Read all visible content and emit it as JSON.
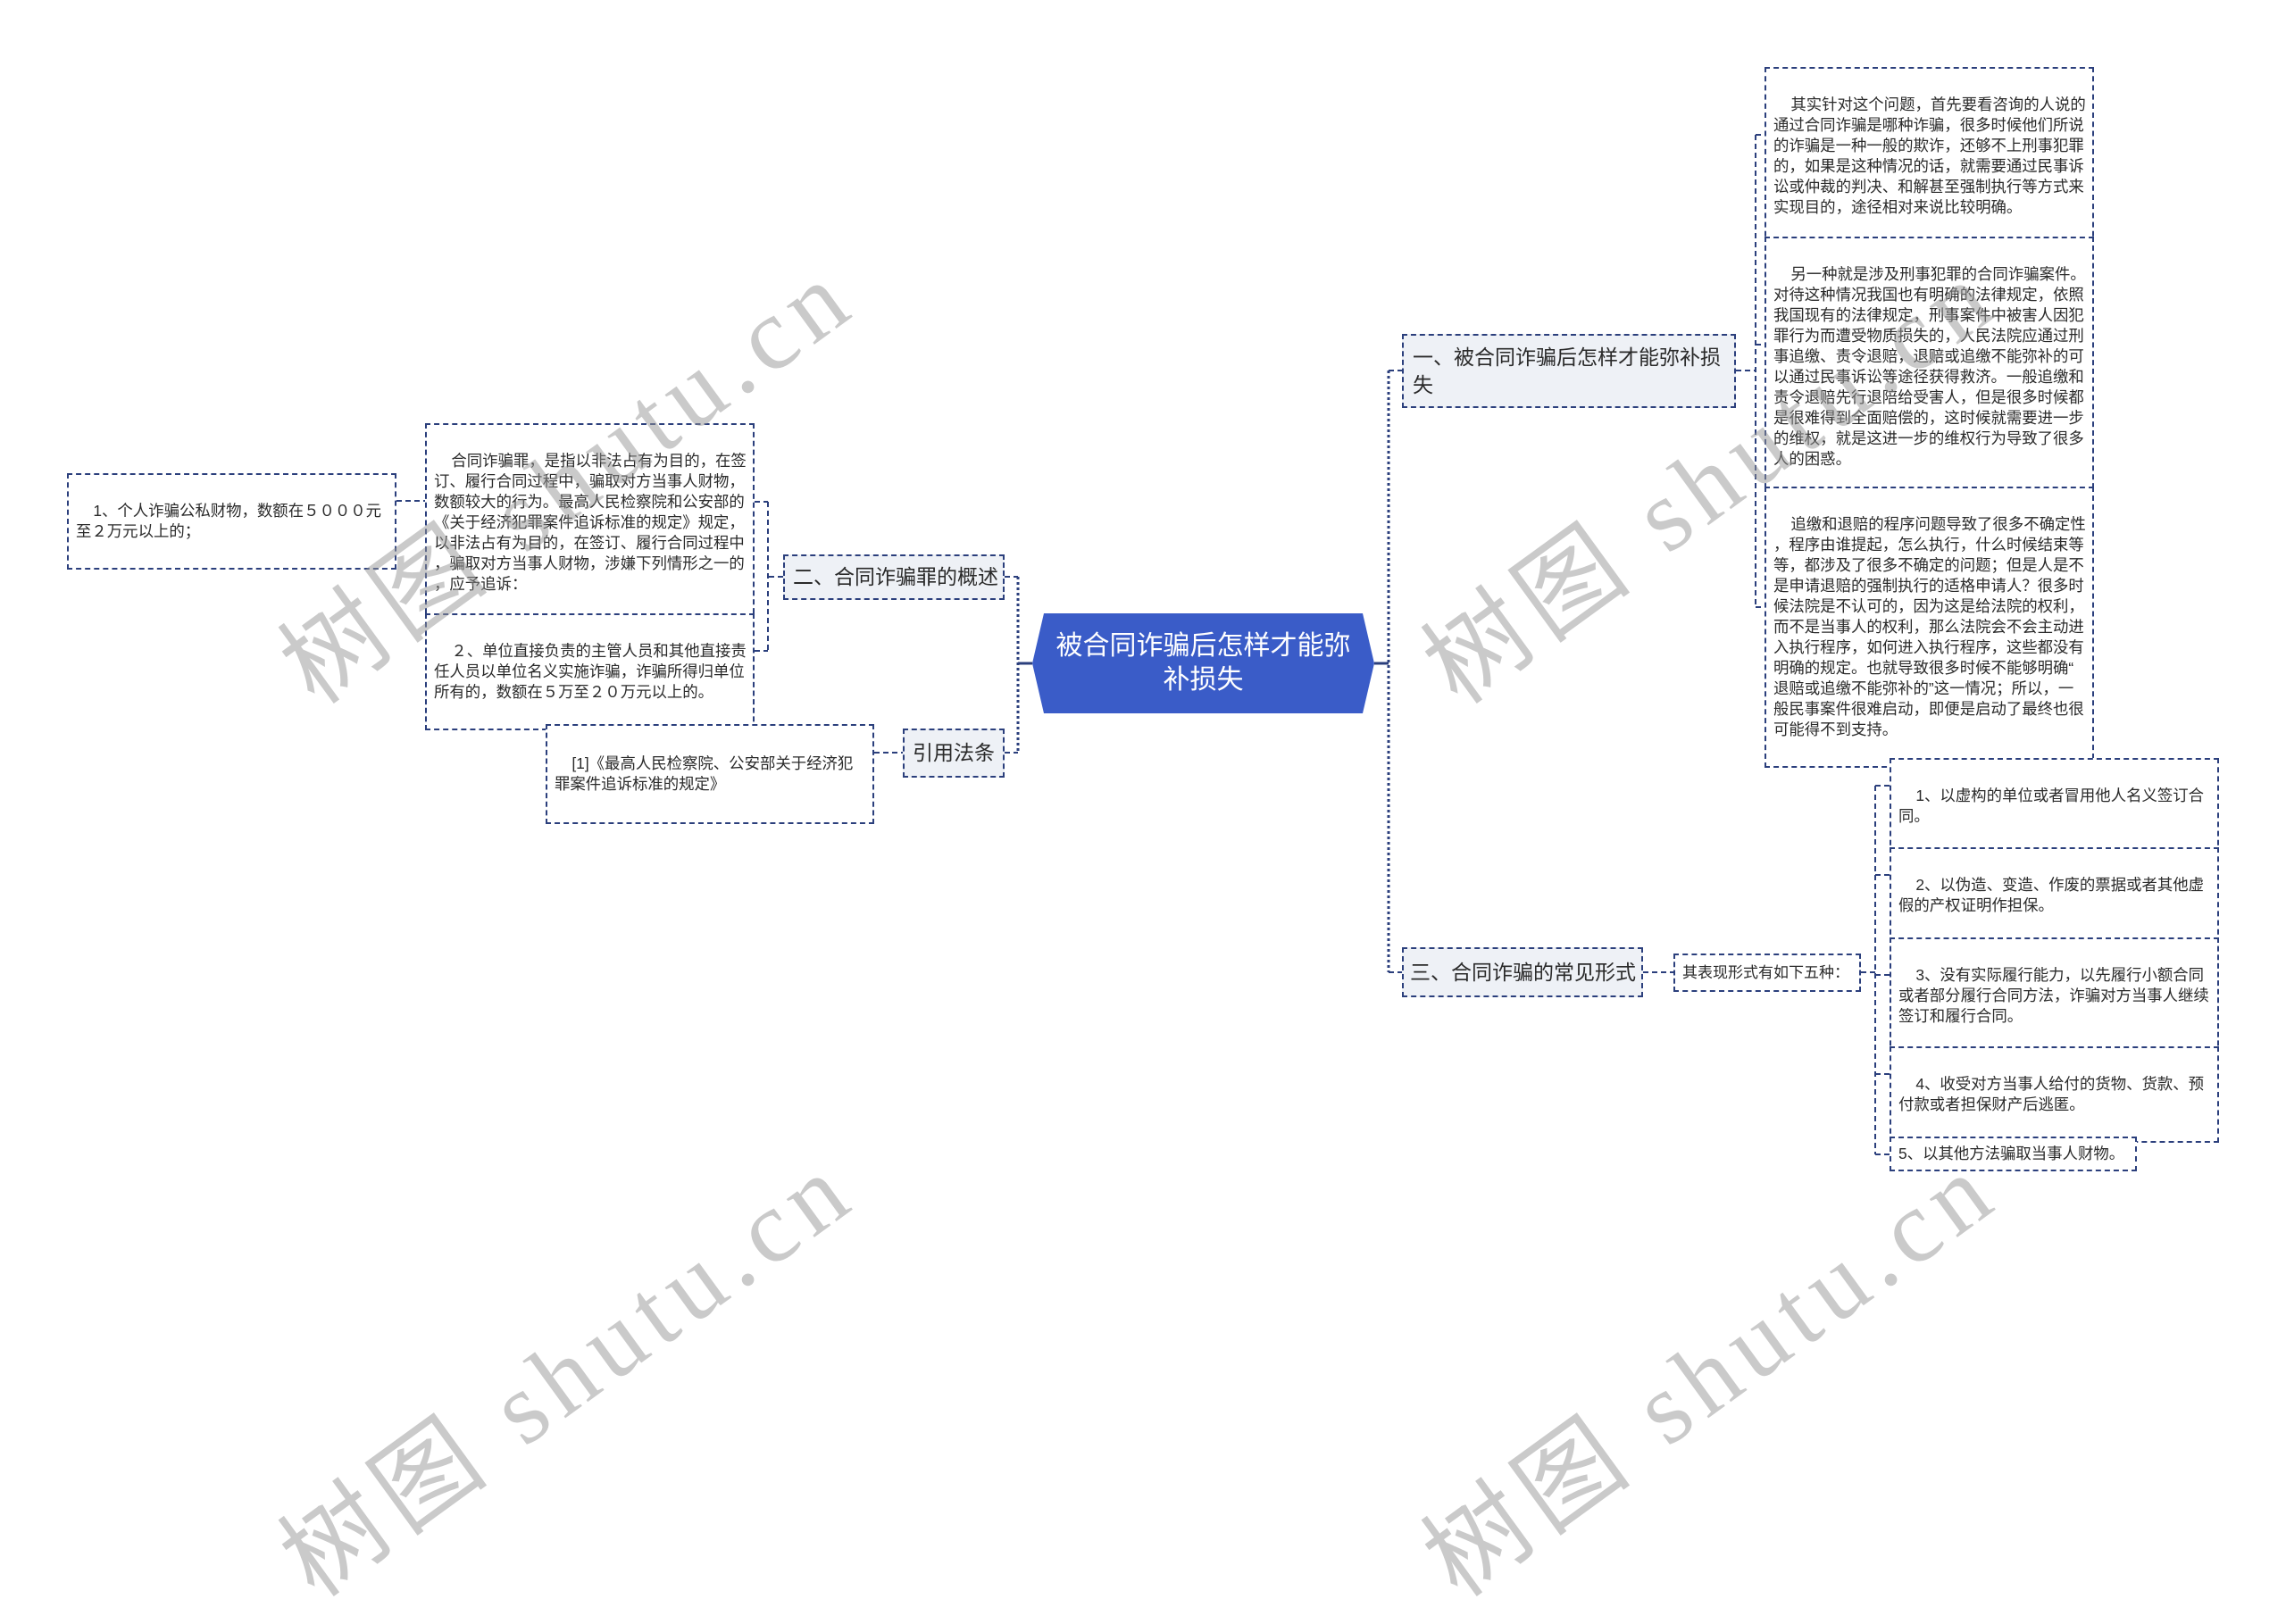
{
  "theme": {
    "root_fill": "#3a5cc8",
    "topic_fill": "#eef1f6",
    "border": "#2b3f7c",
    "text": "#2a2a2a",
    "root_text": "#ffffff"
  },
  "watermark": {
    "text": "树图 shutu.cn"
  },
  "mindmap": {
    "root": {
      "label": "被合同诈骗后怎样才能弥补损失"
    },
    "right": [
      {
        "label": "一、被合同诈骗后怎样才能弥补损失",
        "children": [
          {
            "text": "其实针对这个问题，首先要看咨询的人说的通过合同诈骗是哪种诈骗，很多时候他们所说的诈骗是一种一般的欺诈，还够不上刑事犯罪的，如果是这种情况的话，就需要通过民事诉讼或仲裁的判决、和解甚至强制执行等方式来实现目的，途径相对来说比较明确。"
          },
          {
            "text": "另一种就是涉及刑事犯罪的合同诈骗案件。对待这种情况我国也有明确的法律规定，依照我国现有的法律规定，刑事案件中被害人因犯罪行为而遭受物质损失的，人民法院应通过刑事追缴、责令退赔，退赔或追缴不能弥补的可以通过民事诉讼等途径获得救济。一般追缴和责令退赔先行退陪给受害人，但是很多时候都是很难得到全面赔偿的，这时候就需要进一步的维权，就是这进一步的维权行为导致了很多人的困惑。"
          },
          {
            "text": "追缴和退赔的程序问题导致了很多不确定性，程序由谁提起，怎么执行，什么时候结束等等，都涉及了很多不确定的问题；但是人是不是申请退赔的强制执行的适格申请人？很多时候法院是不认可的，因为这是给法院的权利，而不是当事人的权利，那么法院会不会主动进入执行程序，如何进入执行程序，这些都没有明确的规定。也就导致很多时候不能够明确“退赔或追缴不能弥补的”这一情况；所以，一般民事案件很难启动，即便是启动了最终也很可能得不到支持。"
          }
        ]
      },
      {
        "label": "三、合同诈骗的常见形式",
        "children": [
          {
            "label": "其表现形式有如下五种：",
            "children": [
              {
                "text": "1、以虚构的单位或者冒用他人名义签订合同。"
              },
              {
                "text": "2、以伪造、变造、作废的票据或者其他虚假的产权证明作担保。"
              },
              {
                "text": "3、没有实际履行能力，以先履行小额合同或者部分履行合同方法，诈骗对方当事人继续签订和履行合同。"
              },
              {
                "text": "4、收受对方当事人给付的货物、货款、预付款或者担保财产后逃匿。"
              },
              {
                "text": "5、以其他方法骗取当事人财物。"
              }
            ]
          }
        ]
      }
    ],
    "left": [
      {
        "label": "二、合同诈骗罪的概述",
        "children": [
          {
            "text": "合同诈骗罪，是指以非法占有为目的，在签订、履行合同过程中，骗取对方当事人财物，数额较大的行为。最高人民检察院和公安部的《关于经济犯罪案件追诉标准的规定》规定，以非法占有为目的，在签订、履行合同过程中，骗取对方当事人财物，涉嫌下列情形之一的，应予追诉：",
            "children": [
              {
                "text": "1、个人诈骗公私财物，数额在５０００元至２万元以上的；"
              }
            ]
          },
          {
            "text": "２、单位直接负责的主管人员和其他直接责任人员以单位名义实施诈骗，诈骗所得归单位所有的，数额在５万至２０万元以上的。"
          }
        ]
      },
      {
        "label": "引用法条",
        "children": [
          {
            "text": "[1]《最高人民检察院、公安部关于经济犯罪案件追诉标准的规定》"
          }
        ]
      }
    ]
  }
}
